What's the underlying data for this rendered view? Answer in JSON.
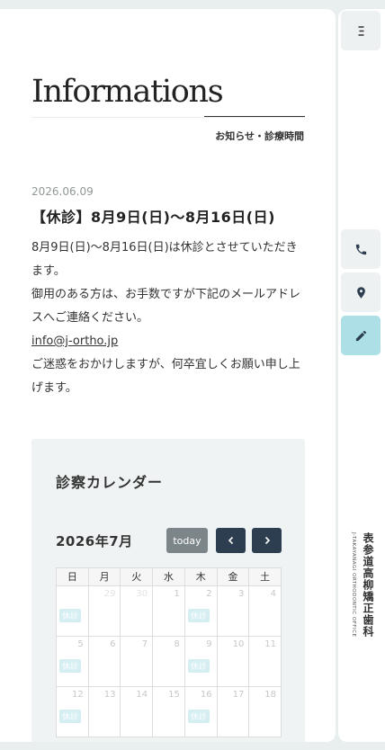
{
  "sidebar": {
    "menu_icon": "hamburger-menu-icon",
    "phone_icon": "phone-icon",
    "map_icon": "map-pin-icon",
    "pen_icon": "pencil-icon",
    "accent_color": "#ace0e6",
    "logo_jp": "表参道高柳矯正歯科",
    "logo_en": "J-TAKAYANAGI ORTHODONTIC OFFICE"
  },
  "page": {
    "title": "Informations",
    "subtitle": "お知らせ・診療時間"
  },
  "post": {
    "date": "2026.06.09",
    "title": "【休診】8月9日(日)～8月16日(日)",
    "body": [
      "8月9日(日)～8月16日(日)は休診とさせていただきます。",
      "御用のある方は、お手数ですが下記のメールアドレスへご連絡ください。",
      "info@j-ortho.jp",
      "ご迷惑をおかけしますが、何卒宜しくお願い申し上げます。"
    ]
  },
  "calendar": {
    "heading": "診察カレンダー",
    "month": "2026年7月",
    "today_label": "today",
    "weekdays": [
      "日",
      "月",
      "火",
      "水",
      "木",
      "金",
      "土"
    ],
    "holiday_label": "休診",
    "weeks": [
      [
        {
          "day": "",
          "holiday": true,
          "other": true
        },
        {
          "day": "29",
          "holiday": false,
          "other": true
        },
        {
          "day": "30",
          "holiday": false,
          "other": true
        },
        {
          "day": "1",
          "holiday": false,
          "other": false
        },
        {
          "day": "2",
          "holiday": true,
          "other": false
        },
        {
          "day": "3",
          "holiday": false,
          "other": false
        },
        {
          "day": "4",
          "holiday": false,
          "other": false
        }
      ],
      [
        {
          "day": "5",
          "holiday": true,
          "other": false
        },
        {
          "day": "6",
          "holiday": false,
          "other": false
        },
        {
          "day": "7",
          "holiday": false,
          "other": false
        },
        {
          "day": "8",
          "holiday": false,
          "other": false
        },
        {
          "day": "9",
          "holiday": true,
          "other": false
        },
        {
          "day": "10",
          "holiday": false,
          "other": false
        },
        {
          "day": "11",
          "holiday": false,
          "other": false
        }
      ],
      [
        {
          "day": "12",
          "holiday": true,
          "other": false
        },
        {
          "day": "13",
          "holiday": false,
          "other": false
        },
        {
          "day": "14",
          "holiday": false,
          "other": false
        },
        {
          "day": "15",
          "holiday": false,
          "other": false
        },
        {
          "day": "16",
          "holiday": true,
          "other": false
        },
        {
          "day": "17",
          "holiday": false,
          "other": false
        },
        {
          "day": "18",
          "holiday": false,
          "other": false
        }
      ]
    ]
  }
}
